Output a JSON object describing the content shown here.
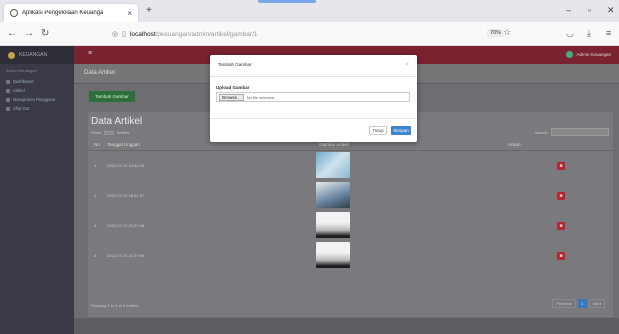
{
  "browser": {
    "tab_title": "Aplikasi Pengelolaan Keuanga",
    "tab_close": "×",
    "new_tab": "+",
    "url_host": "localhost",
    "url_path": "/pkeuangan/admin/artikel/gambar/1",
    "zoom": "70%",
    "back_icon": "arrow-left-icon",
    "forward_icon": "arrow-right-icon",
    "reload_icon": "reload-icon"
  },
  "sidebar": {
    "brand": "KEUANGAN",
    "section": "Admin Keuangan",
    "items": [
      {
        "label": "Dashboard"
      },
      {
        "label": "Artikel"
      },
      {
        "label": "Manajemen Pengguna"
      },
      {
        "label": "Ship Out"
      }
    ]
  },
  "topbar": {
    "menu": "≡",
    "user": "Admin Keuangan"
  },
  "page": {
    "breadcrumb": "Data Artikel",
    "add_button": "Tambah Gambar",
    "card_title": "Data Artikel",
    "show_label": "Show",
    "entries_label": "entries",
    "search_label": "Search:",
    "columns": [
      "No",
      "Tanggal Unggah",
      "Gambar Artikel",
      "Action"
    ],
    "rows": [
      {
        "no": "1",
        "date": "2022-07-24 14:34:25"
      },
      {
        "no": "2",
        "date": "2022-07-24 16:31:07"
      },
      {
        "no": "3",
        "date": "2022-07-24 21:37:45"
      },
      {
        "no": "4",
        "date": "2022-07-24 21:37:59"
      }
    ],
    "footer_info": "Showing 1 to 4 of 4 entries",
    "pager": {
      "prev": "Previous",
      "current": "1",
      "next": "Next"
    }
  },
  "modal": {
    "title": "Tambah Gambar",
    "close": "×",
    "label": "Upload Gambar",
    "browse": "Browse...",
    "file_status": "No file selected.",
    "btn_close": "Tutup",
    "btn_save": "Simpan"
  }
}
